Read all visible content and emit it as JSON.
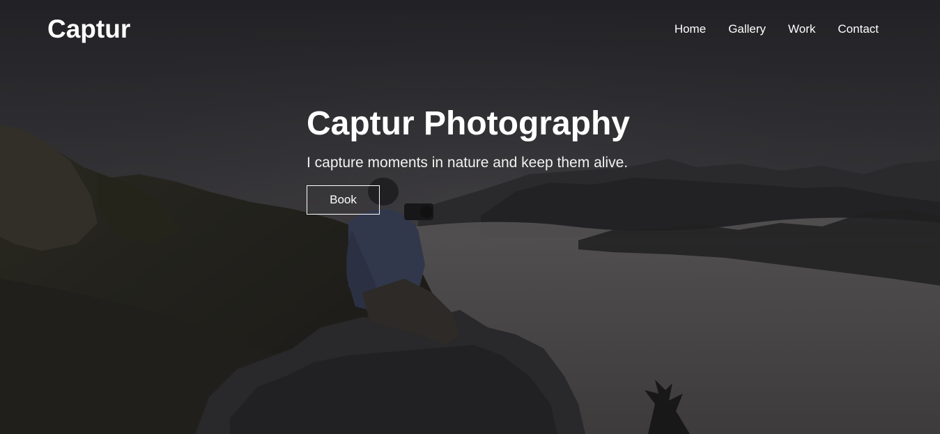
{
  "brand": {
    "logo": "Captur"
  },
  "nav": {
    "items": [
      {
        "label": "Home"
      },
      {
        "label": "Gallery"
      },
      {
        "label": "Work"
      },
      {
        "label": "Contact"
      }
    ]
  },
  "hero": {
    "title": "Captur Photography",
    "subtitle": "I capture moments in nature and keep them alive.",
    "cta_label": "Book",
    "background_image": "mountain-photographer-photo"
  },
  "colors": {
    "overlay": "#141416",
    "text": "#ffffff"
  }
}
